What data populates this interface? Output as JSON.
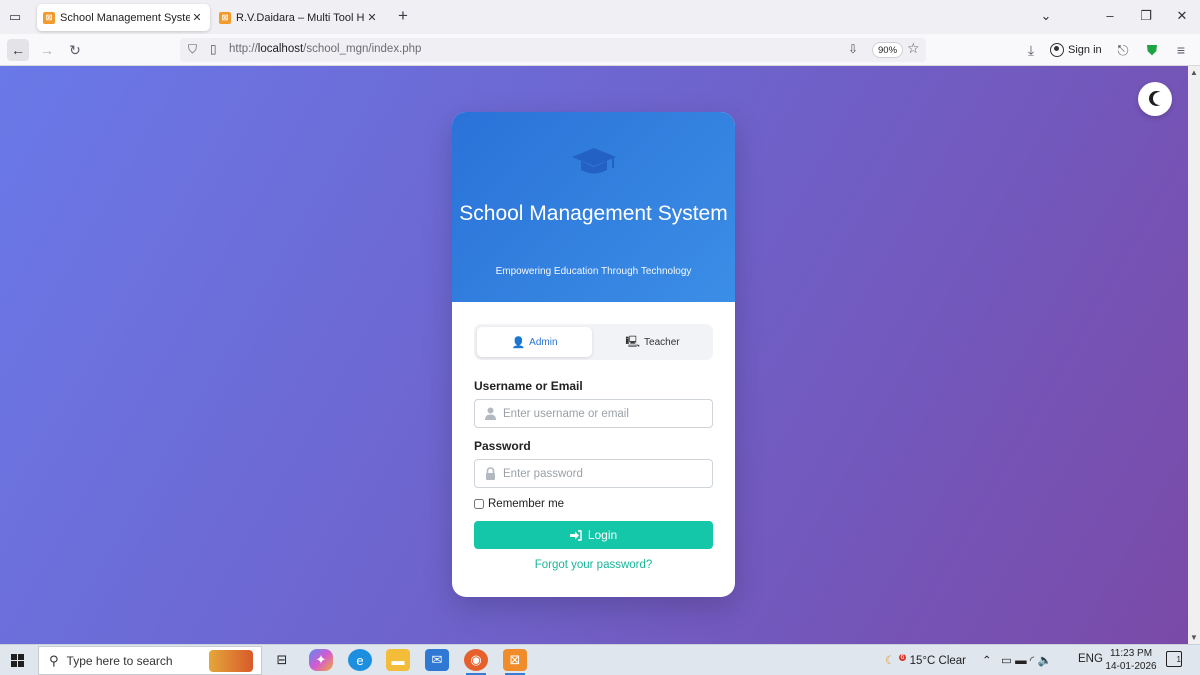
{
  "browser": {
    "tabs": [
      {
        "title": "School Management System - L",
        "active": true
      },
      {
        "title": "R.V.Daidara – Multi Tool Hub",
        "active": false
      }
    ],
    "url_prefix": "http://",
    "url_host": "localhost",
    "url_path": "/school_mgn/index.php",
    "zoom": "90%",
    "sign_in_label": "Sign in"
  },
  "page": {
    "title": "School Management System",
    "subtitle": "Empowering Education Through Technology",
    "roles": [
      {
        "label": "Admin",
        "active": true
      },
      {
        "label": "Teacher",
        "active": false
      }
    ],
    "username_label": "Username or Email",
    "username_placeholder": "Enter username or email",
    "password_label": "Password",
    "password_placeholder": "Enter password",
    "remember_label": "Remember me",
    "remember_checked": false,
    "login_label": "Login",
    "forgot_label": "Forgot your password?",
    "colors": {
      "header": "#2a72d8",
      "accent": "#14c7a8",
      "background_start": "#6a79e8",
      "background_end": "#7a4aa8"
    }
  },
  "taskbar": {
    "search_placeholder": "Type here to search",
    "weather": "15°C  Clear",
    "weather_badge": "6",
    "language": "ENG",
    "time": "11:23 PM",
    "date": "14-01-2026",
    "notification_count": "1"
  }
}
